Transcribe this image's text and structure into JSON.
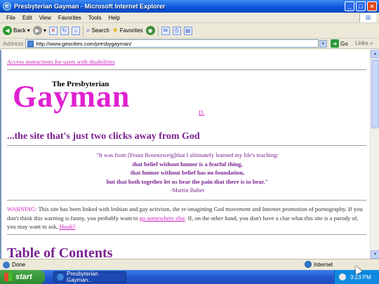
{
  "window": {
    "title": "Presbyterian Gayman - Microsoft Internet Explorer",
    "app_icon": "ie-icon",
    "controls": [
      "_",
      "□",
      "×"
    ]
  },
  "menu": [
    "File",
    "Edit",
    "View",
    "Favorites",
    "Tools",
    "Help"
  ],
  "toolbar": {
    "back_label": "Back",
    "search_label": "Search",
    "favorites_label": "Favorites"
  },
  "address": {
    "label": "Address",
    "url": "http://www.geocities.com/presbygayman/",
    "go_label": "Go",
    "links_label": "Links"
  },
  "page": {
    "access_link": "Access instructions for users with disabilities",
    "logo_small": "The Presbyterian",
    "logo_big": "Gayman",
    "d_link": "D.",
    "tagline": "...the site that's just two clicks away from God",
    "quote": {
      "line1": "\"It was from [Franz Rosenzweig]that I ultimately learned my life's teaching:",
      "line2": "that belief without humor is a fearful thing,",
      "line3": "that humor without belief has no foundation,",
      "line4": "but that both together let us bear the pain that there is to bear.\"",
      "attribution": "-Martin Buber"
    },
    "warning": {
      "label": "WARNING:",
      "text1": " This site has been linked with lesbian and gay activism, the re-imagining God movement and Internet promotion of pornography. If you don't think this warning is funny, you probably want to ",
      "link1": "go somewhere else",
      "text2": ". If, on the other hand, you don't have a clue what this site is a parody of, you may want to ask, ",
      "link2": "Huuh?"
    },
    "toc_heading": "Table of Contents"
  },
  "status": {
    "text": "Done",
    "zone": "Internet"
  },
  "taskbar": {
    "start_label": "start",
    "task_label": "Presbyterian Gayman...",
    "clock": "3:23 PM"
  },
  "colors": {
    "accent_magenta": "#e020d0",
    "heading_purple": "#7a2090",
    "xp_blue": "#2458d0"
  }
}
